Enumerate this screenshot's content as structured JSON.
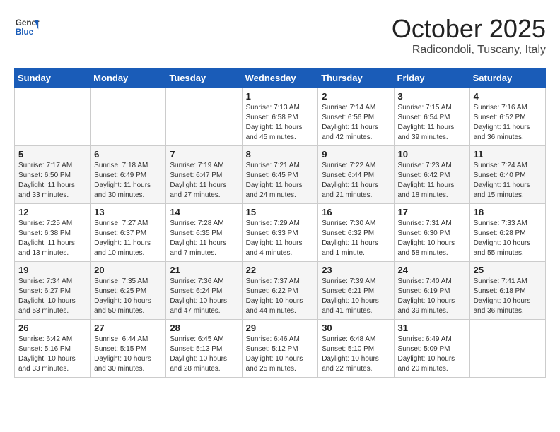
{
  "logo": {
    "general": "General",
    "blue": "Blue"
  },
  "header": {
    "month_title": "October 2025",
    "subtitle": "Radicondoli, Tuscany, Italy"
  },
  "weekdays": [
    "Sunday",
    "Monday",
    "Tuesday",
    "Wednesday",
    "Thursday",
    "Friday",
    "Saturday"
  ],
  "weeks": [
    [
      null,
      null,
      null,
      {
        "day": "1",
        "sunrise": "Sunrise: 7:13 AM",
        "sunset": "Sunset: 6:58 PM",
        "daylight": "Daylight: 11 hours and 45 minutes."
      },
      {
        "day": "2",
        "sunrise": "Sunrise: 7:14 AM",
        "sunset": "Sunset: 6:56 PM",
        "daylight": "Daylight: 11 hours and 42 minutes."
      },
      {
        "day": "3",
        "sunrise": "Sunrise: 7:15 AM",
        "sunset": "Sunset: 6:54 PM",
        "daylight": "Daylight: 11 hours and 39 minutes."
      },
      {
        "day": "4",
        "sunrise": "Sunrise: 7:16 AM",
        "sunset": "Sunset: 6:52 PM",
        "daylight": "Daylight: 11 hours and 36 minutes."
      }
    ],
    [
      {
        "day": "5",
        "sunrise": "Sunrise: 7:17 AM",
        "sunset": "Sunset: 6:50 PM",
        "daylight": "Daylight: 11 hours and 33 minutes."
      },
      {
        "day": "6",
        "sunrise": "Sunrise: 7:18 AM",
        "sunset": "Sunset: 6:49 PM",
        "daylight": "Daylight: 11 hours and 30 minutes."
      },
      {
        "day": "7",
        "sunrise": "Sunrise: 7:19 AM",
        "sunset": "Sunset: 6:47 PM",
        "daylight": "Daylight: 11 hours and 27 minutes."
      },
      {
        "day": "8",
        "sunrise": "Sunrise: 7:21 AM",
        "sunset": "Sunset: 6:45 PM",
        "daylight": "Daylight: 11 hours and 24 minutes."
      },
      {
        "day": "9",
        "sunrise": "Sunrise: 7:22 AM",
        "sunset": "Sunset: 6:44 PM",
        "daylight": "Daylight: 11 hours and 21 minutes."
      },
      {
        "day": "10",
        "sunrise": "Sunrise: 7:23 AM",
        "sunset": "Sunset: 6:42 PM",
        "daylight": "Daylight: 11 hours and 18 minutes."
      },
      {
        "day": "11",
        "sunrise": "Sunrise: 7:24 AM",
        "sunset": "Sunset: 6:40 PM",
        "daylight": "Daylight: 11 hours and 15 minutes."
      }
    ],
    [
      {
        "day": "12",
        "sunrise": "Sunrise: 7:25 AM",
        "sunset": "Sunset: 6:38 PM",
        "daylight": "Daylight: 11 hours and 13 minutes."
      },
      {
        "day": "13",
        "sunrise": "Sunrise: 7:27 AM",
        "sunset": "Sunset: 6:37 PM",
        "daylight": "Daylight: 11 hours and 10 minutes."
      },
      {
        "day": "14",
        "sunrise": "Sunrise: 7:28 AM",
        "sunset": "Sunset: 6:35 PM",
        "daylight": "Daylight: 11 hours and 7 minutes."
      },
      {
        "day": "15",
        "sunrise": "Sunrise: 7:29 AM",
        "sunset": "Sunset: 6:33 PM",
        "daylight": "Daylight: 11 hours and 4 minutes."
      },
      {
        "day": "16",
        "sunrise": "Sunrise: 7:30 AM",
        "sunset": "Sunset: 6:32 PM",
        "daylight": "Daylight: 11 hours and 1 minute."
      },
      {
        "day": "17",
        "sunrise": "Sunrise: 7:31 AM",
        "sunset": "Sunset: 6:30 PM",
        "daylight": "Daylight: 10 hours and 58 minutes."
      },
      {
        "day": "18",
        "sunrise": "Sunrise: 7:33 AM",
        "sunset": "Sunset: 6:28 PM",
        "daylight": "Daylight: 10 hours and 55 minutes."
      }
    ],
    [
      {
        "day": "19",
        "sunrise": "Sunrise: 7:34 AM",
        "sunset": "Sunset: 6:27 PM",
        "daylight": "Daylight: 10 hours and 53 minutes."
      },
      {
        "day": "20",
        "sunrise": "Sunrise: 7:35 AM",
        "sunset": "Sunset: 6:25 PM",
        "daylight": "Daylight: 10 hours and 50 minutes."
      },
      {
        "day": "21",
        "sunrise": "Sunrise: 7:36 AM",
        "sunset": "Sunset: 6:24 PM",
        "daylight": "Daylight: 10 hours and 47 minutes."
      },
      {
        "day": "22",
        "sunrise": "Sunrise: 7:37 AM",
        "sunset": "Sunset: 6:22 PM",
        "daylight": "Daylight: 10 hours and 44 minutes."
      },
      {
        "day": "23",
        "sunrise": "Sunrise: 7:39 AM",
        "sunset": "Sunset: 6:21 PM",
        "daylight": "Daylight: 10 hours and 41 minutes."
      },
      {
        "day": "24",
        "sunrise": "Sunrise: 7:40 AM",
        "sunset": "Sunset: 6:19 PM",
        "daylight": "Daylight: 10 hours and 39 minutes."
      },
      {
        "day": "25",
        "sunrise": "Sunrise: 7:41 AM",
        "sunset": "Sunset: 6:18 PM",
        "daylight": "Daylight: 10 hours and 36 minutes."
      }
    ],
    [
      {
        "day": "26",
        "sunrise": "Sunrise: 6:42 AM",
        "sunset": "Sunset: 5:16 PM",
        "daylight": "Daylight: 10 hours and 33 minutes."
      },
      {
        "day": "27",
        "sunrise": "Sunrise: 6:44 AM",
        "sunset": "Sunset: 5:15 PM",
        "daylight": "Daylight: 10 hours and 30 minutes."
      },
      {
        "day": "28",
        "sunrise": "Sunrise: 6:45 AM",
        "sunset": "Sunset: 5:13 PM",
        "daylight": "Daylight: 10 hours and 28 minutes."
      },
      {
        "day": "29",
        "sunrise": "Sunrise: 6:46 AM",
        "sunset": "Sunset: 5:12 PM",
        "daylight": "Daylight: 10 hours and 25 minutes."
      },
      {
        "day": "30",
        "sunrise": "Sunrise: 6:48 AM",
        "sunset": "Sunset: 5:10 PM",
        "daylight": "Daylight: 10 hours and 22 minutes."
      },
      {
        "day": "31",
        "sunrise": "Sunrise: 6:49 AM",
        "sunset": "Sunset: 5:09 PM",
        "daylight": "Daylight: 10 hours and 20 minutes."
      },
      null
    ]
  ]
}
